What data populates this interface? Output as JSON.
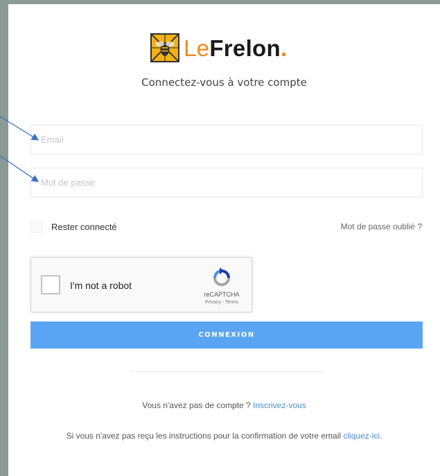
{
  "brand": {
    "name_prefix": "Le",
    "name_main": "Frelon",
    "name_suffix": ".",
    "accent_color": "#ef8a1a",
    "logo_color": "#f2b215"
  },
  "login": {
    "subtitle": "Connectez-vous à votre compte",
    "email_placeholder": "Email",
    "password_placeholder": "Mot de passe",
    "remember_label": "Rester connecté",
    "forgot_link": "Mot de passe oublié ?",
    "submit_label": "CONNEXION",
    "submit_color": "#5aa5f3"
  },
  "recaptcha": {
    "label": "I'm not a robot",
    "brand": "reCAPTCHA",
    "links": "Privacy - Terms"
  },
  "footer": {
    "signup_text": "Vous n'avez pas de compte ? ",
    "signup_link": "Inscrivez-vous",
    "confirm_text": "Si vous n'avez pas reçu les instructions pour la confirmation de votre email ",
    "confirm_link": "cliquez-ici",
    "confirm_end": "."
  }
}
